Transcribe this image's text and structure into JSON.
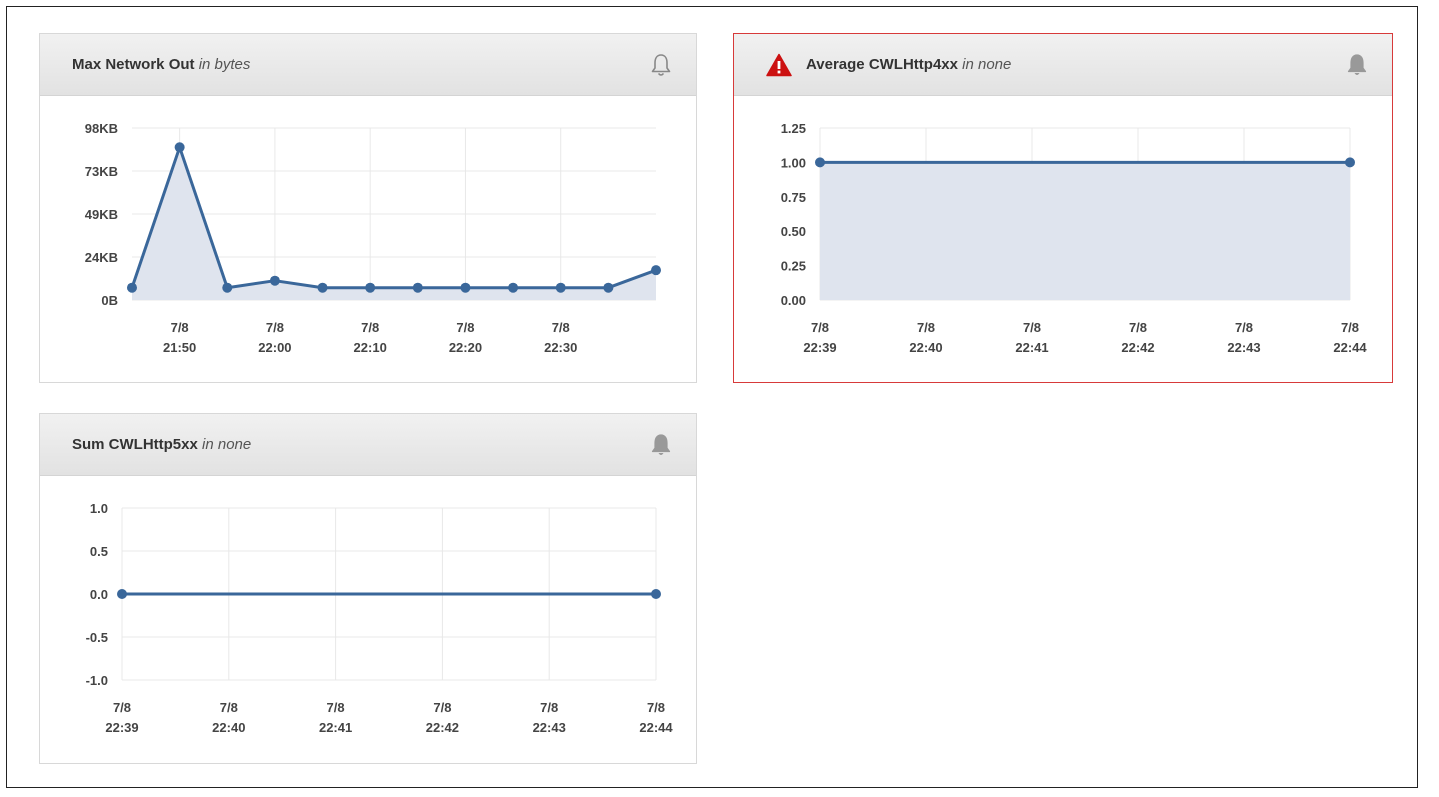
{
  "panels": {
    "network": {
      "metric": "Max Network Out",
      "unit_text": "in bytes"
    },
    "http4xx": {
      "metric": "Average CWLHttp4xx",
      "unit_text": "in none"
    },
    "http5xx": {
      "metric": "Sum CWLHttp5xx",
      "unit_text": "in none"
    }
  },
  "icons": {
    "bell_outline": "bell-outline-icon",
    "bell_filled": "bell-filled-icon",
    "alarm": "alarm-warning-icon"
  },
  "colors": {
    "series": "#3a679a",
    "fill": "#dfe4ee",
    "alarm_border": "#d73a3a",
    "alarm_icon": "#cc1111"
  },
  "chart_data": [
    {
      "type": "area",
      "title": "Max Network Out in bytes",
      "ylabel": "",
      "xlabel": "",
      "yticks": [
        "0B",
        "24KB",
        "49KB",
        "73KB",
        "98KB"
      ],
      "ylim": [
        0,
        98
      ],
      "xticks": [
        [
          "7/8",
          "21:50"
        ],
        [
          "7/8",
          "22:00"
        ],
        [
          "7/8",
          "22:10"
        ],
        [
          "7/8",
          "22:20"
        ],
        [
          "7/8",
          "22:30"
        ]
      ],
      "x": [
        "21:45",
        "21:50",
        "21:55",
        "22:00",
        "22:05",
        "22:10",
        "22:15",
        "22:20",
        "22:25",
        "22:30",
        "22:35",
        "22:40"
      ],
      "series": [
        {
          "values": [
            7,
            87,
            7,
            11,
            7,
            7,
            7,
            7,
            7,
            7,
            7,
            17
          ]
        }
      ],
      "grid": true
    },
    {
      "type": "area",
      "title": "Average CWLHttp4xx in none",
      "yticks": [
        "0.00",
        "0.25",
        "0.50",
        "0.75",
        "1.00",
        "1.25"
      ],
      "ylim": [
        0,
        1.25
      ],
      "xticks": [
        [
          "7/8",
          "22:39"
        ],
        [
          "7/8",
          "22:40"
        ],
        [
          "7/8",
          "22:41"
        ],
        [
          "7/8",
          "22:42"
        ],
        [
          "7/8",
          "22:43"
        ],
        [
          "7/8",
          "22:44"
        ]
      ],
      "x": [
        "22:39",
        "22:44"
      ],
      "series": [
        {
          "values": [
            1.0,
            1.0
          ]
        }
      ],
      "grid": true
    },
    {
      "type": "line",
      "title": "Sum CWLHttp5xx in none",
      "yticks": [
        "-1.0",
        "-0.5",
        "0.0",
        "0.5",
        "1.0"
      ],
      "ylim": [
        -1.0,
        1.0
      ],
      "xticks": [
        [
          "7/8",
          "22:39"
        ],
        [
          "7/8",
          "22:40"
        ],
        [
          "7/8",
          "22:41"
        ],
        [
          "7/8",
          "22:42"
        ],
        [
          "7/8",
          "22:43"
        ],
        [
          "7/8",
          "22:44"
        ]
      ],
      "x": [
        "22:39",
        "22:44"
      ],
      "series": [
        {
          "values": [
            0.0,
            0.0
          ]
        }
      ],
      "grid": true
    }
  ]
}
